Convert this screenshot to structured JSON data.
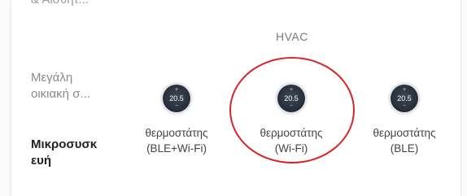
{
  "sidebar": {
    "items": [
      {
        "label": "& Αισθητ..."
      },
      {
        "label": "Μεγάλη οικιακή σ..."
      },
      {
        "label": "Μικροσυσκ ευή"
      }
    ]
  },
  "section": {
    "title": "HVAC"
  },
  "devices": [
    {
      "temp": "20.5",
      "plus": "+",
      "minus": "−",
      "name_line1": "θερμοστάτης",
      "name_line2": "(BLE+Wi-Fi)"
    },
    {
      "temp": "20.5",
      "plus": "+",
      "minus": "−",
      "name_line1": "θερμοστάτης",
      "name_line2": "(Wi-Fi)"
    },
    {
      "temp": "20.5",
      "plus": "+",
      "minus": "−",
      "name_line1": "θερμοστάτης",
      "name_line2": "(BLE)"
    }
  ],
  "colors": {
    "highlight": "#d7262b",
    "selected_text": "#222222",
    "muted_text": "#8a8a8a"
  }
}
